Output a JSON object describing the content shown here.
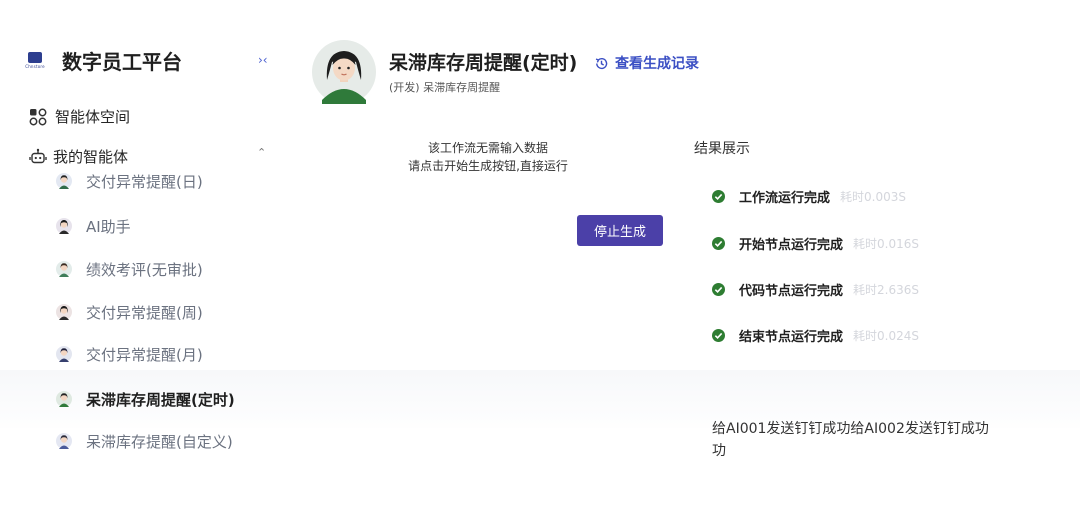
{
  "sidebar": {
    "brand": {
      "title": "数字员工平台",
      "logo_sub": "Chnstore",
      "logo_icon": "brand-logo"
    },
    "collapse_glyph": "›‹",
    "space": {
      "label": "智能体空间",
      "icon": "grid-icon"
    },
    "mine": {
      "label": "我的智能体",
      "icon": "robot-icon",
      "expanded": true
    },
    "agents": [
      {
        "label": "交付异常提醒(日)",
        "avatar": "person-avatar",
        "active": false
      },
      {
        "label": "AI助手",
        "avatar": "person-avatar",
        "active": false
      },
      {
        "label": "绩效考评(无审批)",
        "avatar": "person-avatar",
        "active": false
      },
      {
        "label": "交付异常提醒(周)",
        "avatar": "person-avatar",
        "active": false
      },
      {
        "label": "交付异常提醒(月)",
        "avatar": "person-avatar",
        "active": false
      },
      {
        "label": "呆滞库存周提醒(定时)",
        "avatar": "person-avatar",
        "active": true
      },
      {
        "label": "呆滞库存提醒(自定义)",
        "avatar": "person-avatar",
        "active": false
      }
    ]
  },
  "header": {
    "title": "呆滞库存周提醒(定时)",
    "subtitle": "(开发) 呆滞库存周提醒",
    "history_label": "查看生成记录",
    "history_icon": "history-icon"
  },
  "main": {
    "notice_line1": "该工作流无需输入数据",
    "notice_line2": "请点击开始生成按钮,直接运行",
    "stop_label": "停止生成"
  },
  "results": {
    "title": "结果展示",
    "steps": [
      {
        "label": "工作流运行完成",
        "time": "耗时0.003S"
      },
      {
        "label": "开始节点运行完成",
        "time": "耗时0.016S"
      },
      {
        "label": "代码节点运行完成",
        "time": "耗时2.636S"
      },
      {
        "label": "结束节点运行完成",
        "time": "耗时0.024S"
      }
    ],
    "output_line1": "给AI001发送钉钉成功给AI002发送钉钉成功",
    "output_line2": "功"
  },
  "colors": {
    "accent": "#3b4fc4",
    "button": "#4b40a8",
    "success": "#2e7d32",
    "avatar_green": "#2f7a3a"
  }
}
